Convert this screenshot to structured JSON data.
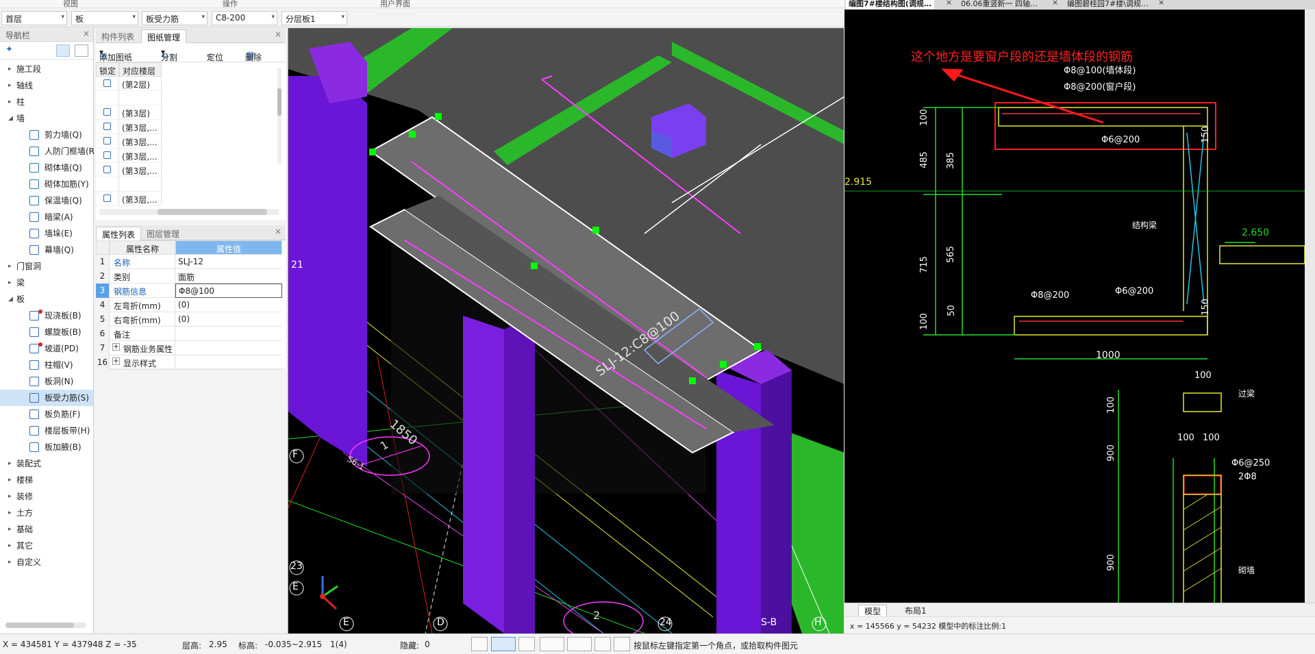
{
  "ribbon": {
    "view": "视图",
    "operate": "操作",
    "ui": "用户界面"
  },
  "selectors": {
    "floor": "首层",
    "category": "板",
    "component": "板受力筋",
    "spec": "C8-200",
    "layer": "分层板1"
  },
  "nav": {
    "title": "导航栏",
    "items": [
      {
        "label": "施工段",
        "tri": "›",
        "level": 0
      },
      {
        "label": "轴线",
        "tri": "›",
        "level": 0
      },
      {
        "label": "柱",
        "tri": "›",
        "level": 0
      },
      {
        "label": "墙",
        "tri": "⌄",
        "level": 0
      },
      {
        "label": "剪力墙(Q)",
        "level": 1
      },
      {
        "label": "人防门框墙(R",
        "level": 1
      },
      {
        "label": "砌体墙(Q)",
        "level": 1
      },
      {
        "label": "砌体加筋(Y)",
        "level": 1
      },
      {
        "label": "保温墙(Q)",
        "level": 1
      },
      {
        "label": "暗梁(A)",
        "level": 1
      },
      {
        "label": "墙垛(E)",
        "level": 1
      },
      {
        "label": "幕墙(Q)",
        "level": 1
      },
      {
        "label": "门窗洞",
        "tri": "›",
        "level": 0
      },
      {
        "label": "梁",
        "tri": "›",
        "level": 0
      },
      {
        "label": "板",
        "tri": "⌄",
        "level": 0
      },
      {
        "label": "现浇板(B)",
        "level": 1,
        "dot": true
      },
      {
        "label": "螺旋板(B)",
        "level": 1
      },
      {
        "label": "坡道(PD)",
        "level": 1,
        "dot": true
      },
      {
        "label": "柱帽(V)",
        "level": 1
      },
      {
        "label": "板洞(N)",
        "level": 1
      },
      {
        "label": "板受力筋(S)",
        "level": 1,
        "selected": true
      },
      {
        "label": "板负筋(F)",
        "level": 1
      },
      {
        "label": "楼层板带(H)",
        "level": 1
      },
      {
        "label": "板加腋(B)",
        "level": 1
      },
      {
        "label": "装配式",
        "tri": "›",
        "level": 0
      },
      {
        "label": "楼梯",
        "tri": "›",
        "level": 0
      },
      {
        "label": "装修",
        "tri": "›",
        "level": 0
      },
      {
        "label": "土方",
        "tri": "›",
        "level": 0
      },
      {
        "label": "基础",
        "tri": "›",
        "level": 0
      },
      {
        "label": "其它",
        "tri": "›",
        "level": 0
      },
      {
        "label": "自定义",
        "tri": "›",
        "level": 0
      }
    ]
  },
  "drawing_panel": {
    "tabs": [
      "构件列表",
      "图纸管理"
    ],
    "tools": [
      "添加图纸",
      "分割",
      "定位",
      "删除"
    ],
    "headers": [
      "锁定",
      "对应楼层"
    ],
    "rows": [
      "(第2层)",
      "",
      "(第3层)",
      "(第3层,...",
      "(第3层,...",
      "(第3层,...",
      "(第3层,...",
      "",
      "(第3层,..."
    ]
  },
  "props": {
    "tabs": [
      "属性列表",
      "图层管理"
    ],
    "headers": [
      "属性名称",
      "属性值"
    ],
    "rows": [
      {
        "n": "1",
        "k": "名称",
        "v": "SLJ-12",
        "blue": true
      },
      {
        "n": "2",
        "k": "类别",
        "v": "面筋"
      },
      {
        "n": "3",
        "k": "钢筋信息",
        "v": "Φ8@100",
        "blue": true,
        "edit": true
      },
      {
        "n": "4",
        "k": "左弯折(mm)",
        "v": "(0)"
      },
      {
        "n": "5",
        "k": "右弯折(mm)",
        "v": "(0)"
      },
      {
        "n": "6",
        "k": "备注",
        "v": ""
      },
      {
        "n": "7",
        "k": "钢筋业务属性",
        "v": "",
        "plus": true
      },
      {
        "n": "16",
        "k": "显示样式",
        "v": "",
        "plus": true
      }
    ]
  },
  "viewport": {
    "rebar_label": "SLJ-12:C8@100",
    "dims": [
      "1850"
    ],
    "axis_labels": [
      "F",
      "21",
      "23",
      "E",
      "E",
      "D",
      "24",
      "S-B",
      "H"
    ],
    "bubble_text": "1",
    "bubble_ref": "S6-1",
    "bubble_text2": "2"
  },
  "cad": {
    "tabs": [
      "编图7#楼结构图(调规…",
      "06.06重竖新一 四轴…",
      "编图碧桂园7#楼\\调规…"
    ],
    "annotation": "这个地方是要窗户段的还是墙体段的钢筋",
    "texts": [
      "Φ8@100(墙体段)",
      "Φ8@200(窗户段)",
      "Φ6@200",
      "Φ8@200",
      "Φ6@200",
      "100",
      "385",
      "485",
      "565",
      "715",
      "50",
      "100",
      "150",
      "150",
      "2.915",
      "2.650",
      "结构梁",
      "1000",
      "100",
      "100",
      "过梁",
      "900",
      "100",
      "100",
      "Φ6@250",
      "2Φ8",
      "900",
      "砌墙"
    ],
    "layout_tabs": [
      "模型",
      "布局1"
    ],
    "status": "x = 145566  y = 54232   模型中的标注比例:1"
  },
  "status": {
    "coords": "X = 434581 Y = 437948 Z = -35",
    "floor_height_label": "层高:",
    "floor_height": "2.95",
    "elevation_label": "标高:",
    "elevation": "-0.035~2.915",
    "count": "1(4)",
    "hidden_label": "隐藏:",
    "hidden": "0",
    "hint": "按鼠标左键指定第一个角点，或拾取构件图元"
  }
}
